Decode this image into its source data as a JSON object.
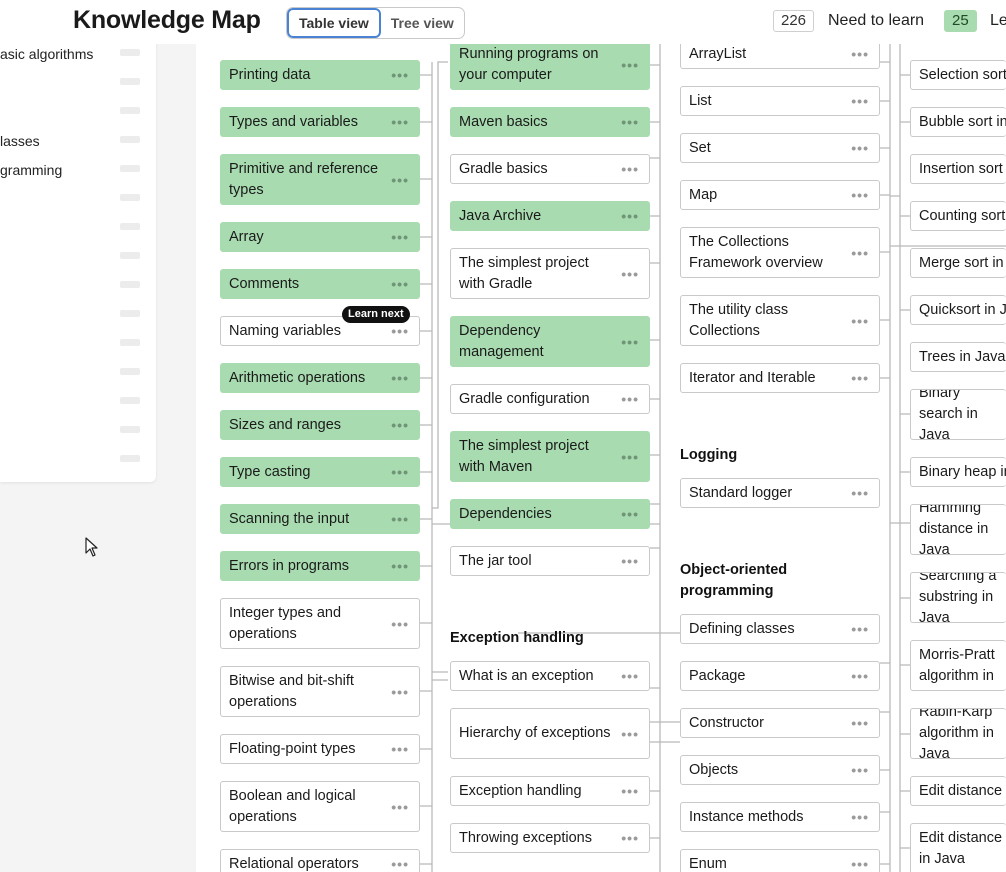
{
  "header": {
    "title": "Knowledge Map",
    "view_toggle": [
      "Table view",
      "Tree view"
    ],
    "need_to_learn_count": "226",
    "need_to_learn_label": "Need to learn",
    "learned_count": "25",
    "learned_label": "Le"
  },
  "sidebar": {
    "items": [
      "asic algorithms",
      "lasses",
      "gramming"
    ]
  },
  "learn_next_badge": "Learn next",
  "col1": [
    "Printing data",
    "Types and variables",
    "Primitive and reference types",
    "Array",
    "Comments",
    "Naming variables",
    "Arithmetic operations",
    "Sizes and ranges",
    "Type casting",
    "Scanning the input",
    "Errors in programs",
    "Integer types and operations",
    "Bitwise and bit-shift operations",
    "Floating-point types",
    "Boolean and logical operations",
    "Relational operators"
  ],
  "col2": [
    "Running programs on your computer",
    "Maven basics",
    "Gradle basics",
    "Java Archive",
    "The simplest project with Gradle",
    "Dependency management",
    "Gradle configuration",
    "The simplest project with Maven",
    "Dependencies",
    "The jar tool"
  ],
  "col2_section": "Exception handling",
  "col2b": [
    "What is an exception",
    "Hierarchy of exceptions",
    "Exception handling",
    "Throwing exceptions"
  ],
  "col3": [
    "ArrayList",
    "List",
    "Set",
    "Map",
    "The Collections Framework overview",
    "The utility class Collections",
    "Iterator and Iterable"
  ],
  "col3_section_logging": "Logging",
  "col3_logging": [
    "Standard logger"
  ],
  "col3_section_oop": "Object-oriented programming",
  "col3_oop": [
    "Defining classes",
    "Package",
    "Constructor",
    "Objects",
    "Instance methods",
    "Enum"
  ],
  "col4": [
    "Selection sort",
    "Bubble sort in",
    "Insertion sort",
    "Counting sort",
    "Merge sort in",
    "Quicksort in Java",
    "Trees in Java",
    "Binary search in Java",
    "Binary heap in",
    "Hamming distance in Java",
    "Searching a substring in Java",
    "Knuth-Morris-Pratt algorithm in Java",
    "Rabin-Karp algorithm in Java",
    "Edit distance",
    "Edit distance in Java"
  ],
  "colors": {
    "learned": "#a8dcb0",
    "accent": "#4a83d3"
  }
}
